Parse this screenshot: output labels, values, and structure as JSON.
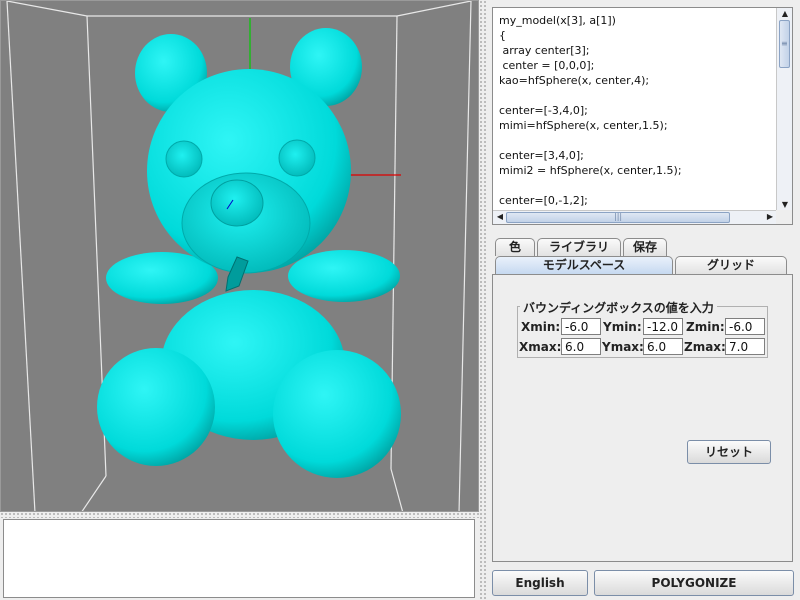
{
  "viewport": {
    "model_color": "#00e6e6",
    "background_color": "#808080"
  },
  "editor": {
    "code_lines": [
      "my_model(x[3], a[1])",
      "{",
      " array center[3];",
      " center = [0,0,0];",
      "kao=hfSphere(x, center,4);",
      "",
      "center=[-3,4,0];",
      "mimi=hfSphere(x, center,1.5);",
      "",
      "center=[3,4,0];",
      "mimi2 = hfSphere(x, center,1.5);",
      "",
      "center=[0,-1,2];"
    ]
  },
  "tabs": {
    "row1": [
      "色",
      "ライブラリ",
      "保存"
    ],
    "row2": [
      "モデルスペース",
      "グリッド"
    ]
  },
  "model_space": {
    "title": "バウンディングボックスの値を入力",
    "xmin_label": "Xmin:",
    "xmin": "-6.0",
    "ymin_label": "Ymin:",
    "ymin": "-12.0",
    "zmin_label": "Zmin:",
    "zmin": "-6.0",
    "xmax_label": "Xmax:",
    "xmax": "6.0",
    "ymax_label": "Ymax:",
    "ymax": "6.0",
    "zmax_label": "Zmax:",
    "zmax": "7.0",
    "reset_label": "リセット"
  },
  "buttons": {
    "english_label": "English",
    "polygonize_label": "POLYGONIZE"
  }
}
